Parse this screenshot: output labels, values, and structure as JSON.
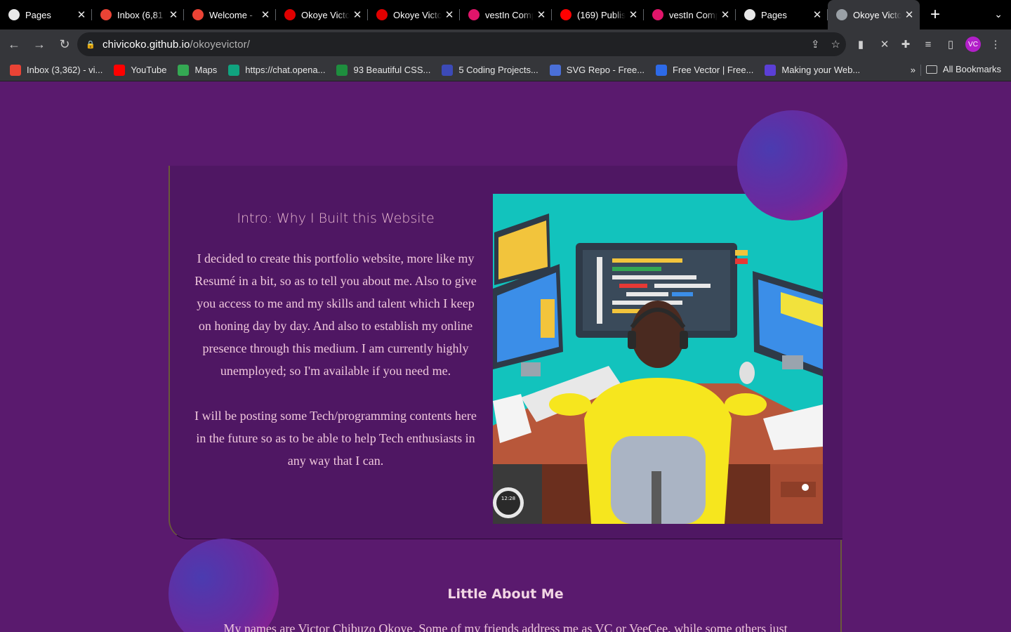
{
  "browser": {
    "tabs": [
      {
        "title": "Pages",
        "icon": "github-icon",
        "color": "#e8e8e8"
      },
      {
        "title": "Inbox (6,81",
        "icon": "gmail-icon",
        "color": "#ea4335"
      },
      {
        "title": "Welcome - ",
        "icon": "gmail-icon",
        "color": "#ea4335"
      },
      {
        "title": "Okoye Victo",
        "icon": "bookmark-red-icon",
        "color": "#e00000"
      },
      {
        "title": "Okoye Victo",
        "icon": "bookmark-red-icon",
        "color": "#e00000"
      },
      {
        "title": "vestIn Comp",
        "icon": "vestin-icon",
        "color": "#e0156a"
      },
      {
        "title": "(169) Publis",
        "icon": "youtube-icon",
        "color": "#ff0000"
      },
      {
        "title": "vestIn Comp",
        "icon": "vestin-icon",
        "color": "#e0156a"
      },
      {
        "title": "Pages",
        "icon": "github-icon",
        "color": "#e8e8e8"
      },
      {
        "title": "Okoye Victo",
        "icon": "globe-icon",
        "color": "#9aa0a6"
      }
    ],
    "new_tab_label": "+",
    "url_host": "chivicoko.github.io",
    "url_path": "/okoyevictor/",
    "avatar_initials": "VC",
    "bookmarks": [
      {
        "label": "Inbox (3,362) - vi...",
        "color": "#ea4335"
      },
      {
        "label": "YouTube",
        "color": "#ff0000"
      },
      {
        "label": "Maps",
        "color": "#34a853"
      },
      {
        "label": "https://chat.opena...",
        "color": "#10a37f"
      },
      {
        "label": "93 Beautiful CSS...",
        "color": "#1e8e3e"
      },
      {
        "label": "5 Coding Projects...",
        "color": "#3c4ab8"
      },
      {
        "label": "SVG Repo - Free...",
        "color": "#4a6fd8"
      },
      {
        "label": "Free Vector | Free...",
        "color": "#2d6ae8"
      },
      {
        "label": "Making your Web...",
        "color": "#5b3fd6"
      }
    ],
    "bookmarks_more": "»",
    "all_bookmarks": "All Bookmarks"
  },
  "intro": {
    "title": "Intro: Why I Built this Website",
    "paragraphs": [
      "I decided to create this portfolio website, more like my Resumé in a bit, so as to tell you about me. Also to give you access to me and my skills and talent which I keep on honing day by day. And also to establish my online presence through this medium. I am currently highly unemployed; so I'm available if you need me.",
      "I will be posting some Tech/programming contents here in the future so as to be able to help Tech enthusiasts in any way that I can."
    ],
    "clock_text": "12:28"
  },
  "about": {
    "title": "Little About Me",
    "text": "My names are Victor Chibuzo Okoye. Some of my friends address me as VC or VeeCee, while some others just"
  },
  "colors": {
    "page_bg": "#5a1a6e",
    "card_bg": "#4f1763",
    "heading": "#e7b7cf",
    "body_text": "#f0c8dc"
  }
}
